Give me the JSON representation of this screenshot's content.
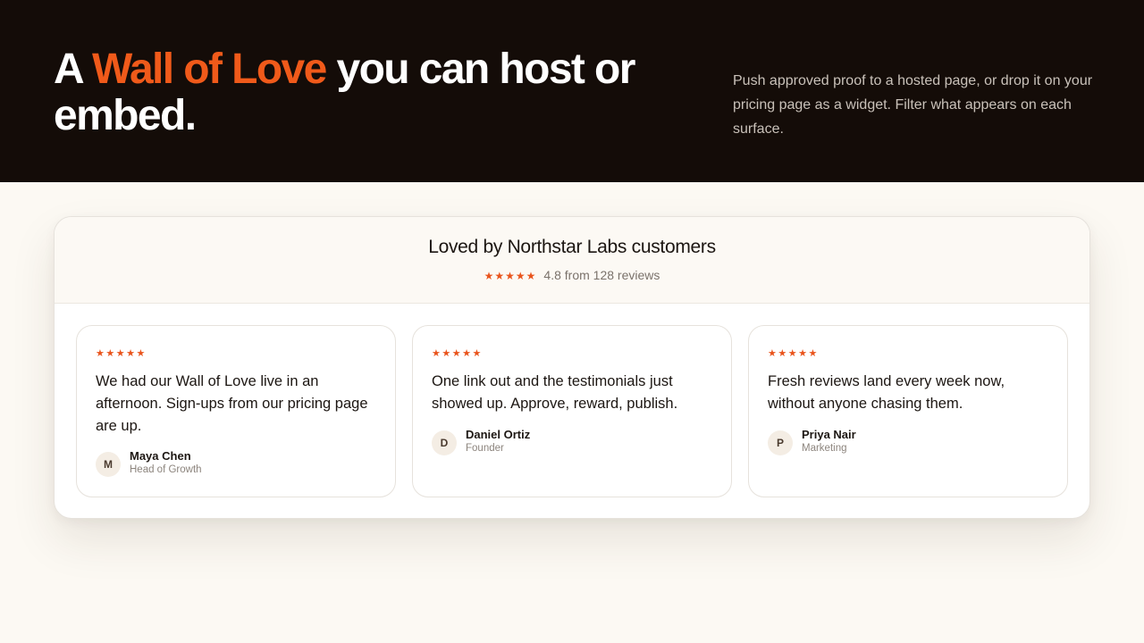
{
  "hero": {
    "title_prefix": "A ",
    "title_accent": "Wall of Love",
    "title_suffix": " you can host or embed.",
    "description": "Push approved proof to a hosted page, or drop it on your pricing page as a widget. Filter what appears on each surface."
  },
  "widget": {
    "title": "Loved by Northstar Labs customers",
    "stars": "★★★★★",
    "rating_text": "4.8 from 128 reviews",
    "rating_value": 4.8,
    "review_count": 128
  },
  "testimonials": [
    {
      "stars": "★★★★★",
      "quote": "We had our Wall of Love live in an afternoon. Sign-ups from our pricing page are up.",
      "initial": "M",
      "name": "Maya Chen",
      "role": "Head of Growth"
    },
    {
      "stars": "★★★★★",
      "quote": "One link out and the testimonials just showed up. Approve, reward, publish.",
      "initial": "D",
      "name": "Daniel Ortiz",
      "role": "Founder"
    },
    {
      "stars": "★★★★★",
      "quote": "Fresh reviews land every week now, without anyone chasing them.",
      "initial": "P",
      "name": "Priya Nair",
      "role": "Marketing"
    }
  ],
  "colors": {
    "hero_background": "#140c08",
    "accent": "#f05a1a",
    "star": "#e9541c",
    "page_background": "#fcf9f3"
  }
}
